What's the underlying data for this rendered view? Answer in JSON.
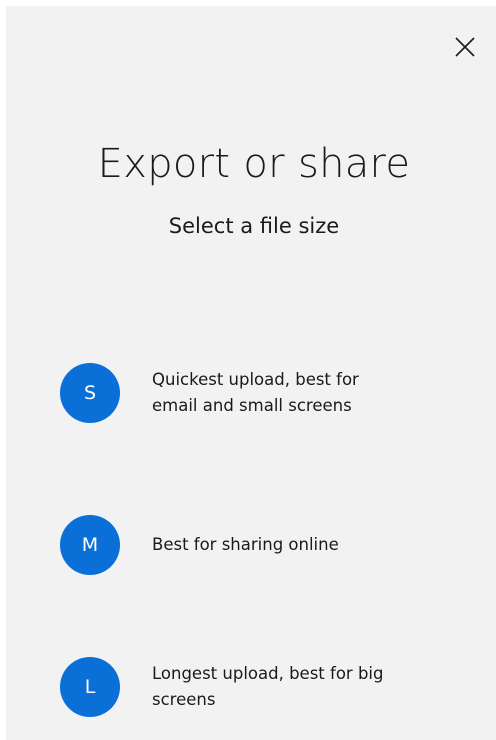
{
  "dialog": {
    "title": "Export or share",
    "subtitle": "Select a file size",
    "close_icon": "close-icon",
    "accent_color": "#0a6fd6",
    "options": [
      {
        "letter": "S",
        "label_line1": "Quickest upload, best for",
        "label_line2": "email and small screens"
      },
      {
        "letter": "M",
        "label_line1": "Best for sharing online",
        "label_line2": ""
      },
      {
        "letter": "L",
        "label_line1": "Longest upload, best for big",
        "label_line2": "screens"
      }
    ]
  }
}
